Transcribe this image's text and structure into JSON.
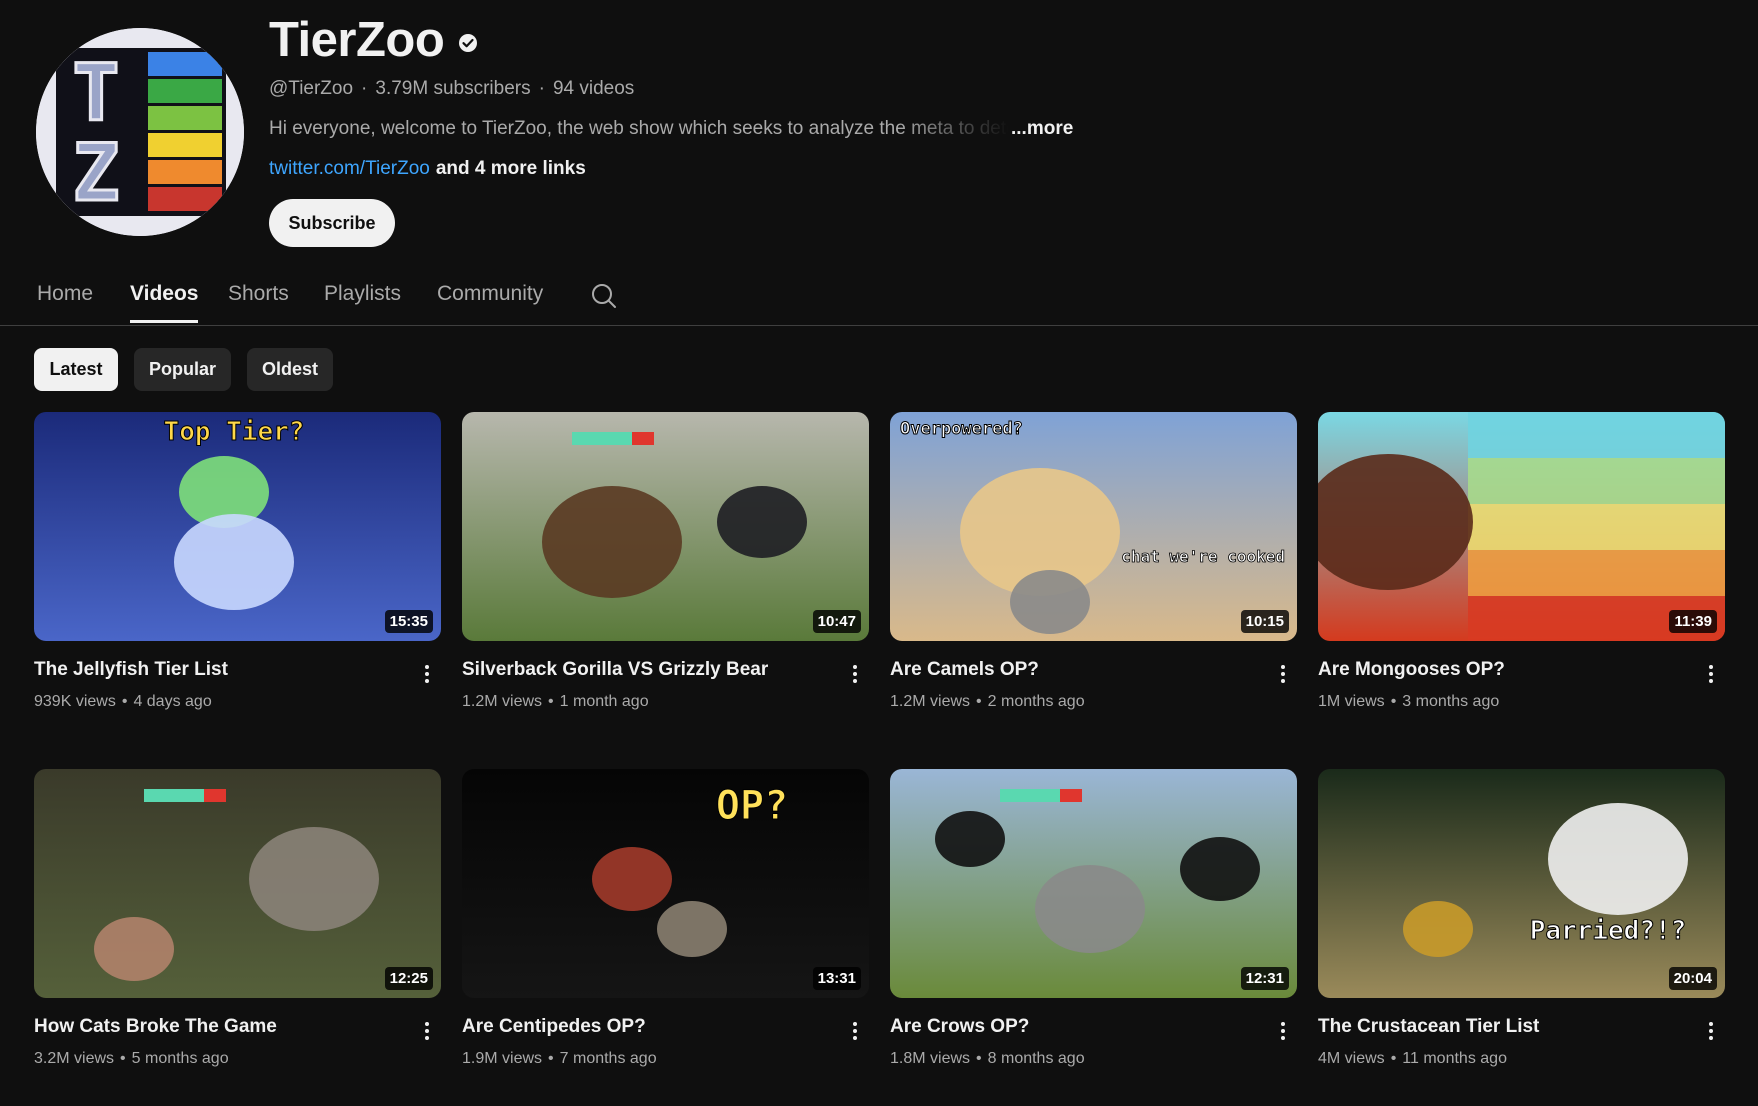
{
  "channel": {
    "name": "TierZoo",
    "handle": "@TierZoo",
    "subscribers": "3.79M subscribers",
    "video_count": "94 videos",
    "separator": "·",
    "description": "Hi everyone, welcome to TierZoo, the web show which seeks to analyze the meta to deter",
    "more_label": "...more",
    "link": "twitter.com/TierZoo",
    "more_links": "and 4 more links",
    "subscribe_label": "Subscribe",
    "avatar_letters": [
      "T",
      "Z"
    ],
    "avatar_bar_colors": [
      "#3b82e6",
      "#3aa845",
      "#7cc242",
      "#f0d030",
      "#ef8a2e",
      "#c8362e"
    ]
  },
  "tabs": [
    {
      "label": "Home",
      "active": false
    },
    {
      "label": "Videos",
      "active": true
    },
    {
      "label": "Shorts",
      "active": false
    },
    {
      "label": "Playlists",
      "active": false
    },
    {
      "label": "Community",
      "active": false
    }
  ],
  "chips": [
    {
      "label": "Latest",
      "selected": true
    },
    {
      "label": "Popular",
      "selected": false
    },
    {
      "label": "Oldest",
      "selected": false
    }
  ],
  "videos": [
    {
      "title": "The Jellyfish Tier List",
      "views": "939K views",
      "age": "4 days ago",
      "duration": "15:35",
      "overlay": "Top Tier?"
    },
    {
      "title": "Silverback Gorilla VS Grizzly Bear",
      "views": "1.2M views",
      "age": "1 month ago",
      "duration": "10:47"
    },
    {
      "title": "Are Camels OP?",
      "views": "1.2M views",
      "age": "2 months ago",
      "duration": "10:15",
      "overlay": "Overpowered?",
      "overlay2": "chat we're cooked"
    },
    {
      "title": "Are Mongooses OP?",
      "views": "1M views",
      "age": "3 months ago",
      "duration": "11:39"
    },
    {
      "title": "How Cats Broke The Game",
      "views": "3.2M views",
      "age": "5 months ago",
      "duration": "12:25"
    },
    {
      "title": "Are Centipedes OP?",
      "views": "1.9M views",
      "age": "7 months ago",
      "duration": "13:31",
      "overlay": "OP?"
    },
    {
      "title": "Are Crows OP?",
      "views": "1.8M views",
      "age": "8 months ago",
      "duration": "12:31"
    },
    {
      "title": "The Crustacean Tier List",
      "views": "4M views",
      "age": "11 months ago",
      "duration": "20:04",
      "overlay": "Parried?!?"
    }
  ],
  "bullet": "•"
}
